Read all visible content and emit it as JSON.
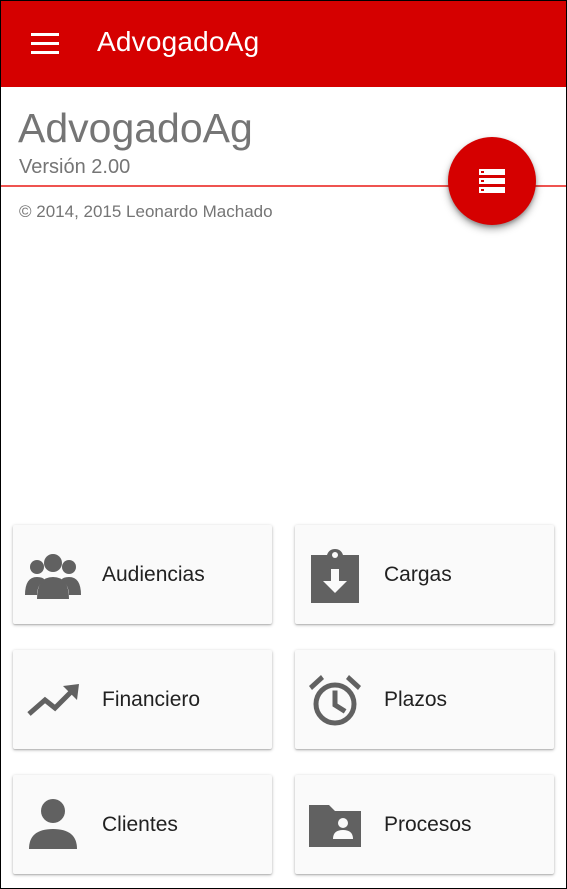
{
  "appbar": {
    "title": "AdvogadoAg",
    "menu_icon": "menu-icon",
    "color": "#d50000"
  },
  "header": {
    "title": "AdvogadoAg",
    "version": "Versión 2.00",
    "copyright": "© 2014, 2015 Leonardo Machado",
    "divider_color": "#ef5350"
  },
  "fab": {
    "icon": "list-view-icon",
    "color": "#d50000"
  },
  "menu": {
    "items": [
      {
        "label": "Audiencias",
        "icon": "group-icon"
      },
      {
        "label": "Cargas",
        "icon": "clipboard-download-icon"
      },
      {
        "label": "Financiero",
        "icon": "trending-up-icon"
      },
      {
        "label": "Plazos",
        "icon": "alarm-clock-icon"
      },
      {
        "label": "Clientes",
        "icon": "person-icon"
      },
      {
        "label": "Procesos",
        "icon": "folder-shared-icon"
      }
    ],
    "icon_color": "#616161"
  }
}
